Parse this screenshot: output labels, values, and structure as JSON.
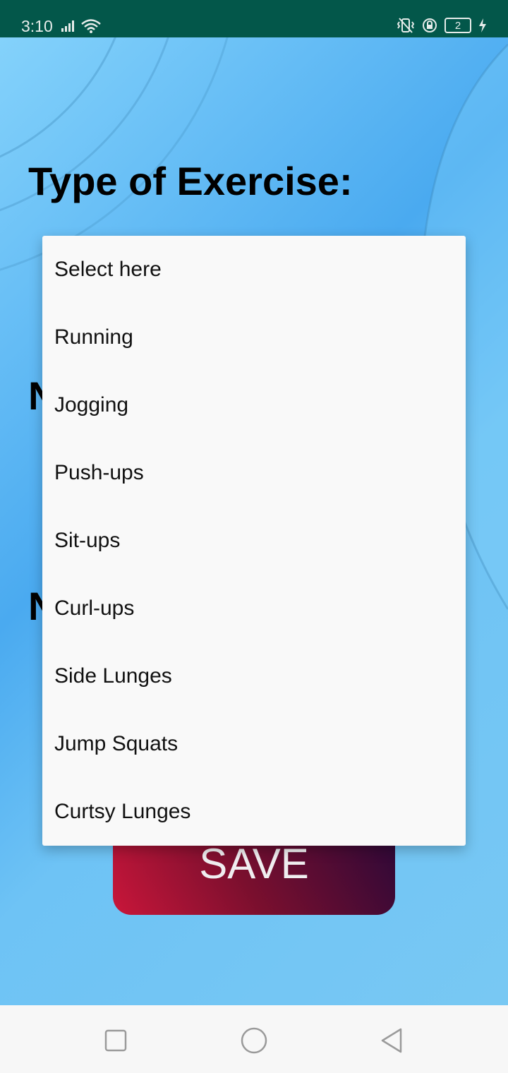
{
  "status_bar": {
    "time": "3:10",
    "battery_level": "2",
    "icons": [
      "signal-icon",
      "wifi-icon",
      "vibrate-icon",
      "rotation-lock-icon",
      "battery-icon",
      "charging-icon"
    ]
  },
  "form": {
    "type_label": "Type of Exercise:",
    "hidden_label_2_visible": "N",
    "hidden_label_3_visible_start": "N",
    "hidden_label_3_visible_end": ":",
    "save_label": "SAVE"
  },
  "dropdown": {
    "options": [
      "Select here",
      "Running",
      "Jogging",
      "Push-ups",
      "Sit-ups",
      "Curl-ups",
      "Side Lunges",
      "Jump Squats",
      "Curtsy Lunges"
    ]
  },
  "nav_bar": {
    "buttons": [
      "recents-icon",
      "home-icon",
      "back-icon"
    ]
  },
  "colors": {
    "status_bar": "#03574a",
    "background": "#76c6f1",
    "save_start": "#c9163a",
    "save_end": "#2a0838",
    "dropdown_bg": "#f9f9f9"
  }
}
